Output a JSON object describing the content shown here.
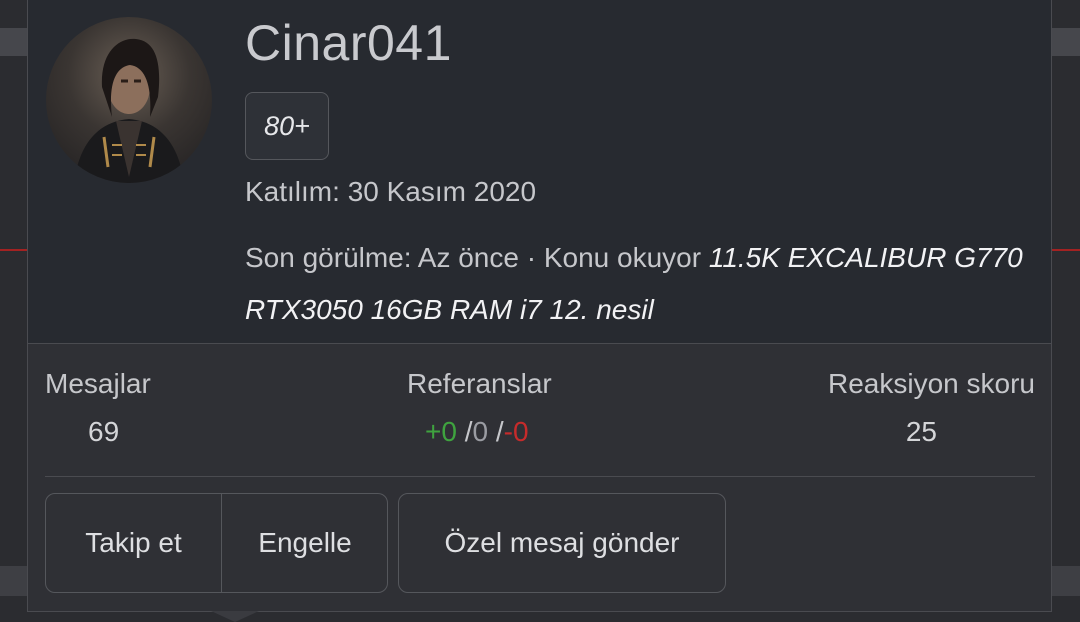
{
  "profile": {
    "username": "Cinar041",
    "badge": "80+",
    "joined": "Katılım: 30 Kasım 2020",
    "last_seen_prefix": "Son görülme: Az önce · Konu okuyor ",
    "last_seen_thread": "11.5K EXCALIBUR G770 RTX3050 16GB RAM i7 12. nesil"
  },
  "stats": {
    "messages_label": "Mesajlar",
    "messages_value": "69",
    "references_label": "Referanslar",
    "references_positive": "+0",
    "references_neutral": "0",
    "references_negative": "-0",
    "references_sep": "/",
    "reaction_label": "Reaksiyon skoru",
    "reaction_value": "25"
  },
  "actions": {
    "follow": "Takip et",
    "ignore": "Engelle",
    "private_message": "Özel mesaj gönder"
  },
  "colors": {
    "positive": "#3fa33f",
    "neutral": "#9a9ca2",
    "negative": "#c62b2b"
  }
}
